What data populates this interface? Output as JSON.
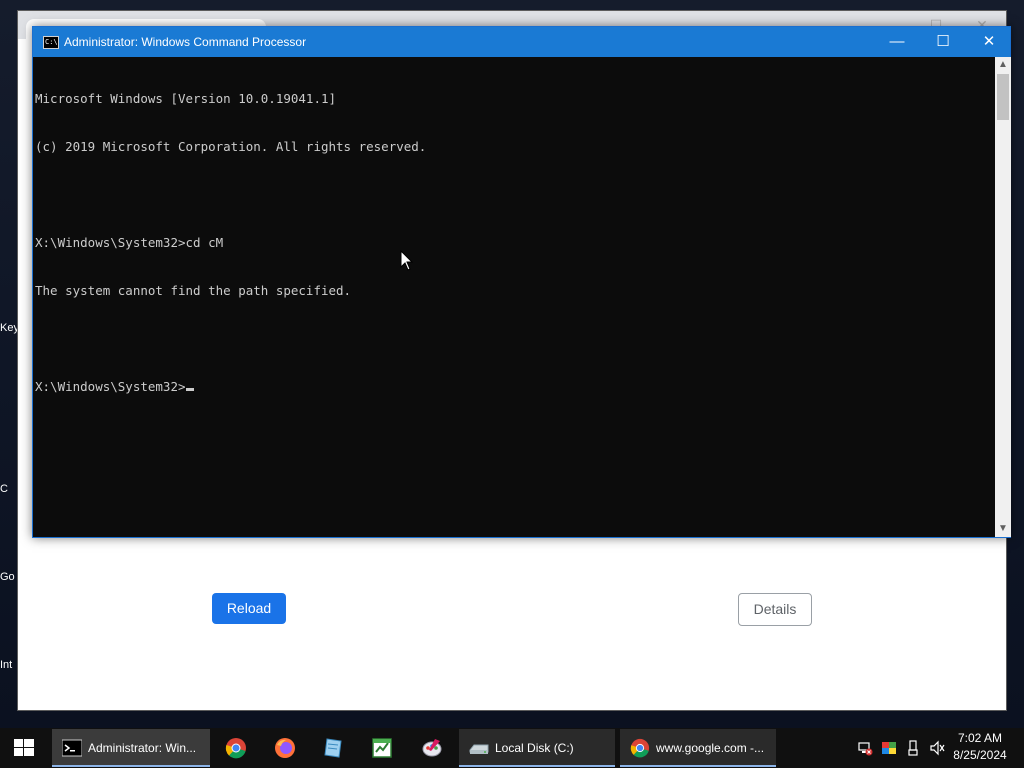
{
  "desktop": {
    "edge_labels": [
      "Key",
      "C",
      "Go",
      "Int"
    ]
  },
  "browser": {
    "reload_label": "Reload",
    "details_label": "Details"
  },
  "cmd": {
    "title": "Administrator: Windows Command Processor",
    "lines": [
      "Microsoft Windows [Version 10.0.19041.1]",
      "(c) 2019 Microsoft Corporation. All rights reserved.",
      "",
      "X:\\Windows\\System32>cd cM",
      "The system cannot find the path specified.",
      "",
      "X:\\Windows\\System32>"
    ],
    "controls": {
      "minimize": "—",
      "maximize": "☐",
      "close": "✕"
    }
  },
  "taskbar": {
    "items": [
      {
        "label": "Administrator: Win...",
        "icon": "cmd-icon"
      },
      {
        "label": "Local Disk (C:)",
        "icon": "drive-icon"
      },
      {
        "label": "www.google.com -...",
        "icon": "chrome-icon"
      }
    ],
    "pinned": [
      "chrome-icon",
      "firefox-icon",
      "notepad-icon",
      "spreadsheet-icon",
      "paint-icon"
    ],
    "clock": {
      "time": "7:02 AM",
      "date": "8/25/2024"
    }
  },
  "colors": {
    "titlebar": "#1a7ad4",
    "console_bg": "#0c0c0c",
    "console_fg": "#cccccc",
    "reload_button": "#1a73e8",
    "taskbar": "#101010"
  }
}
